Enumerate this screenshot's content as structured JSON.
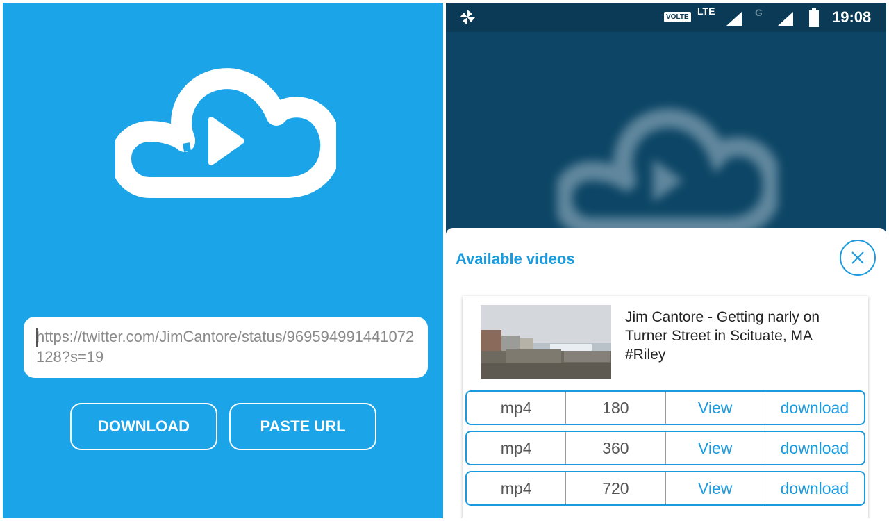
{
  "left_screen": {
    "url_value": "https://twitter.com/JimCantore/status/969594991441072128?s=19",
    "download_label": "DOWNLOAD",
    "paste_label": "PASTE URL",
    "accent_color": "#1ba4e8",
    "logo_icon": "cloud-play-icon"
  },
  "right_screen": {
    "status_bar": {
      "volte": "VOLTE",
      "lte": "LTE",
      "network2": "G",
      "time": "19:08"
    },
    "sheet": {
      "title": "Available videos",
      "video_title": "Jim Cantore - Getting narly on Turner Street in Scituate, MA #Riley",
      "formats": [
        {
          "format": "mp4",
          "quality": "180",
          "view_label": "View",
          "download_label": "download"
        },
        {
          "format": "mp4",
          "quality": "360",
          "view_label": "View",
          "download_label": "download"
        },
        {
          "format": "mp4",
          "quality": "720",
          "view_label": "View",
          "download_label": "download"
        }
      ]
    },
    "accent_color": "#1a9be0"
  }
}
